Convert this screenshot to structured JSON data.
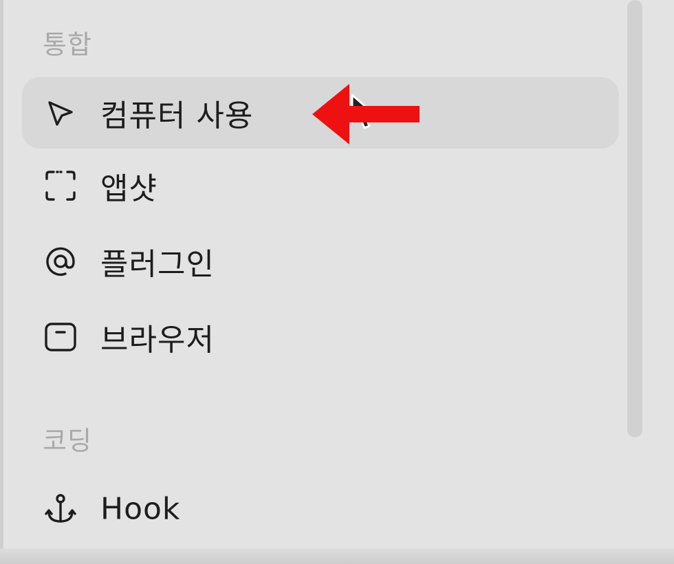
{
  "sidebar": {
    "sections": [
      {
        "header": "통합",
        "items": [
          {
            "label": "컴퓨터 사용",
            "icon": "cursor-arrow-icon",
            "active": true
          },
          {
            "label": "앱샷",
            "icon": "screenshot-frame-icon",
            "active": false
          },
          {
            "label": "플러그인",
            "icon": "at-sign-icon",
            "active": false
          },
          {
            "label": "브라우저",
            "icon": "browser-window-icon",
            "active": false
          }
        ]
      },
      {
        "header": "코딩",
        "items": [
          {
            "label": "Hook",
            "icon": "anchor-icon",
            "active": false
          }
        ]
      }
    ]
  },
  "colors": {
    "background": "#e3e3e3",
    "active_item_background": "#d8d8d8",
    "section_header_text": "#a9a9a9",
    "item_text": "#1d1d1d",
    "annotation_arrow": "#ee1111"
  }
}
